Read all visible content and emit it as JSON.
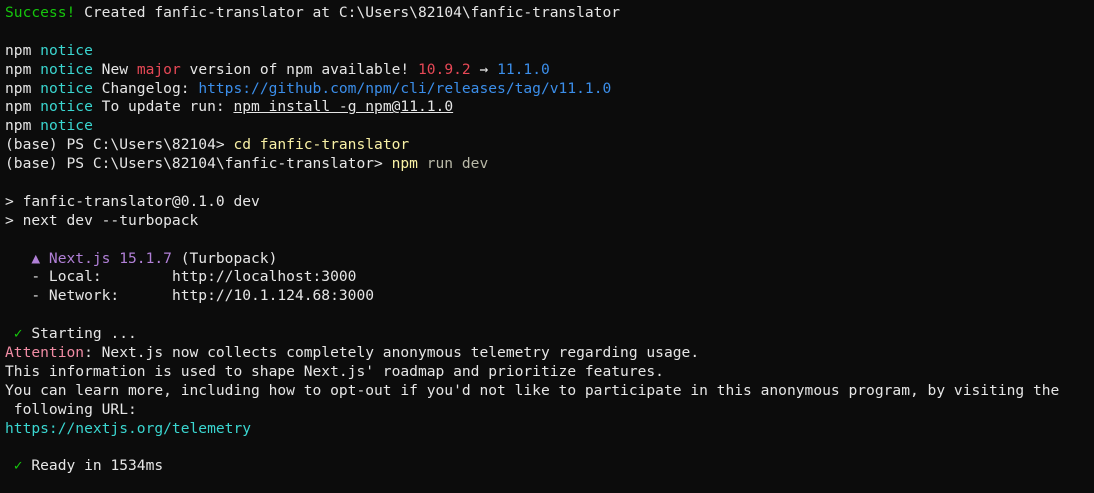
{
  "terminal": {
    "success_prefix": "Success!",
    "success_text": " Created fanfic-translator at C:\\Users\\82104\\fanfic-translator",
    "npm": "npm",
    "notice": "notice",
    "new_version": {
      "pre": " New ",
      "major": "major",
      "mid": " version of npm available! ",
      "old": "10.9.2",
      "arrow": " → ",
      "new": "11.1.0"
    },
    "changelog_label": " Changelog: ",
    "changelog_url": "https://github.com/npm/cli/releases/tag/v11.1.0",
    "update_label": " To update run: ",
    "update_cmd": "npm install -g npm@11.1.0",
    "prompt1": "(base) PS C:\\Users\\82104> ",
    "cmd1": "cd fanfic-translator",
    "prompt2": "(base) PS C:\\Users\\82104\\fanfic-translator> ",
    "cmd2_bin": "npm",
    "cmd2_args": " run dev",
    "script_line1": "> fanfic-translator@0.1.0 dev",
    "script_line2": "> next dev --turbopack",
    "next_badge": "   ▲ Next.js 15.1.7",
    "next_mode": " (Turbopack)",
    "local_label": "   - Local:        ",
    "local_url": "http://localhost:3000",
    "network_label": "   - Network:      ",
    "network_url": "http://10.1.124.68:3000",
    "starting_check": " ✓",
    "starting_text": " Starting ...",
    "attention_label": "Attention",
    "attention_text": ": Next.js now collects completely anonymous telemetry regarding usage.",
    "info_line1": "This information is used to shape Next.js' roadmap and prioritize features.",
    "info_line2": "You can learn more, including how to opt-out if you'd not like to participate in this anonymous program, by visiting the",
    "info_line3": " following URL:",
    "telemetry_url": "https://nextjs.org/telemetry",
    "ready_check": " ✓",
    "ready_text": " Ready in 1534ms"
  }
}
